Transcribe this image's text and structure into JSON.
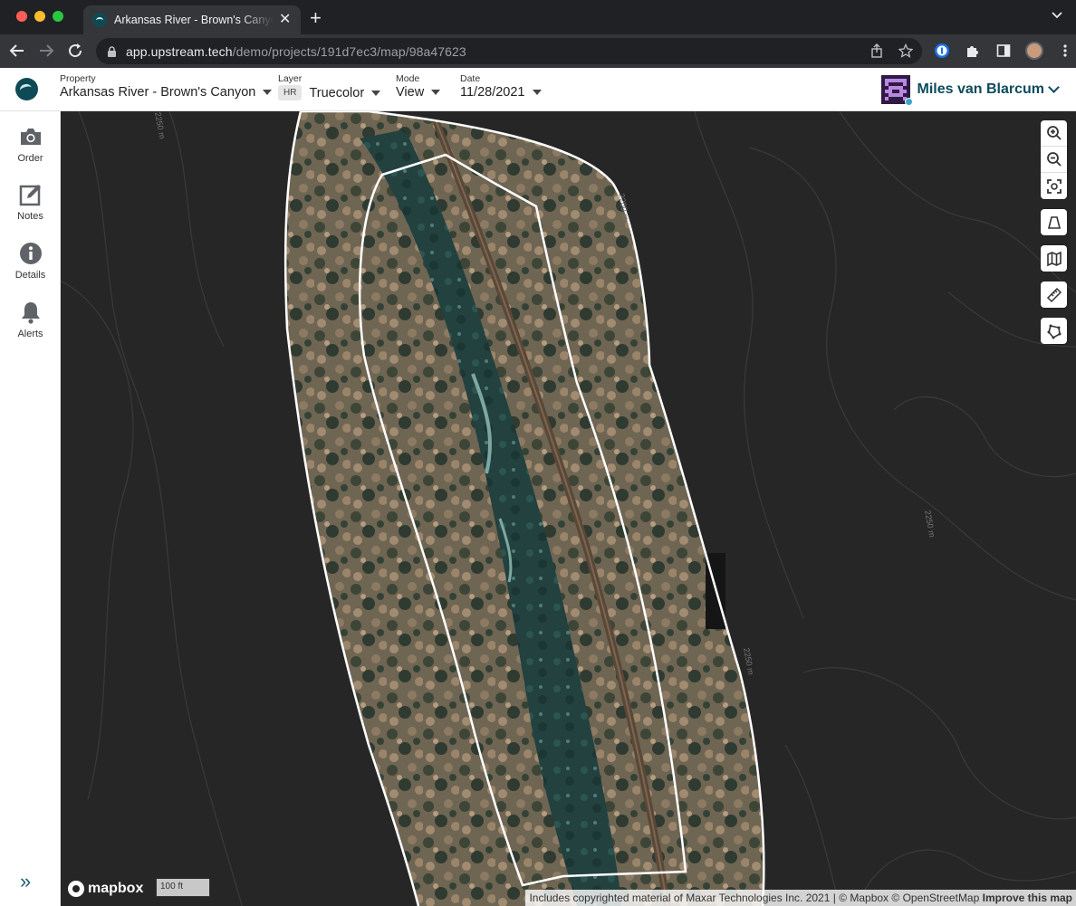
{
  "browser": {
    "tab_title": "Arkansas River - Brown's Canyon",
    "tab_close": "✕",
    "newtab": "+",
    "url_host": "app.upstream.tech",
    "url_path": "/demo/projects/191d7ec3/map/98a47623"
  },
  "header": {
    "property": {
      "label": "Property",
      "value": "Arkansas River - Brown's Canyon"
    },
    "layer": {
      "label": "Layer",
      "badge": "HR",
      "value": "Truecolor"
    },
    "mode": {
      "label": "Mode",
      "value": "View"
    },
    "date": {
      "label": "Date",
      "value": "11/28/2021"
    },
    "user_name": "Miles van Blarcum"
  },
  "sidebar": {
    "items": [
      {
        "label": "Order",
        "icon": "camera-icon"
      },
      {
        "label": "Notes",
        "icon": "edit-note-icon"
      },
      {
        "label": "Details",
        "icon": "info-icon"
      },
      {
        "label": "Alerts",
        "icon": "bell-icon"
      }
    ],
    "collapse": "»"
  },
  "map": {
    "contour_labels": [
      "2250 m",
      "2200 m",
      "2250 m",
      "2250 m"
    ],
    "scale": "100 ft",
    "logo": "mapbox",
    "attribution": "Includes copyrighted material of Maxar Technologies Inc. 2021 | © Mapbox © OpenStreetMap",
    "improve": "Improve this map",
    "controls": [
      "zoom-in-icon",
      "zoom-out-icon",
      "fit-bounds-icon",
      "perspective-icon",
      "map-layers-icon",
      "ruler-icon",
      "draw-polygon-icon"
    ]
  },
  "colors": {
    "brand": "#0e4a55",
    "user_name": "#0b4b5c",
    "map_background": "#262626"
  }
}
